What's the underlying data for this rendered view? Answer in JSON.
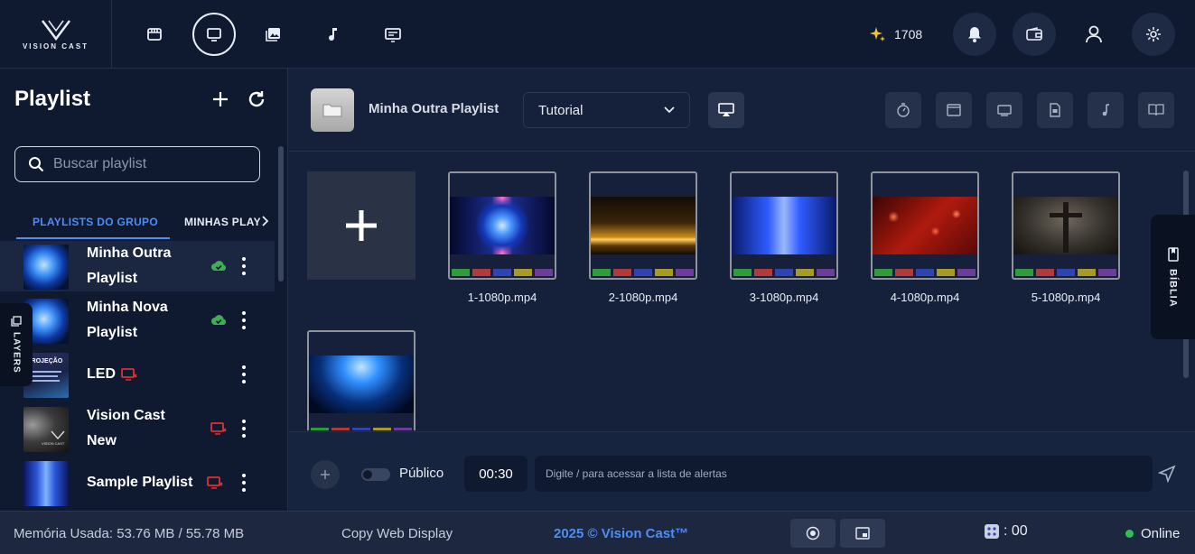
{
  "brand": {
    "name": "VISION CAST"
  },
  "topbar": {
    "nav": [
      {
        "icon": "store-icon"
      },
      {
        "icon": "monitor-icon",
        "active": true
      },
      {
        "icon": "images-icon"
      },
      {
        "icon": "music-icon"
      },
      {
        "icon": "text-screen-icon"
      }
    ],
    "credits": "1708",
    "actions": [
      "bell-icon",
      "wallet-icon",
      "user-icon",
      "settings-icon"
    ]
  },
  "sidebar": {
    "title": "Playlist",
    "search_placeholder": "Buscar playlist",
    "tabs": [
      "PLAYLISTS DO GRUPO",
      "MINHAS PLAYLISTS"
    ],
    "layers_label": "LAYERS",
    "items": [
      {
        "line1": "Minha Outra",
        "line2": "Playlist",
        "status": "cloud-synced",
        "selected": true
      },
      {
        "line1": "Minha Nova",
        "line2": "Playlist",
        "status": "cloud-synced",
        "selected": false
      },
      {
        "line1": "LED",
        "line2": "",
        "status": "cast-offline",
        "selected": false
      },
      {
        "line1": "Vision Cast",
        "line2": "New",
        "status": "cast-offline",
        "selected": false
      },
      {
        "line1": "Sample Playlist",
        "line2": "",
        "status": "cast-offline",
        "selected": false
      }
    ],
    "thumb_texts": {
      "projecao": "PROJEÇÃO",
      "vision": "VISION CAST"
    }
  },
  "main": {
    "playlist_name": "Minha Outra Playlist",
    "dropdown_value": "Tutorial",
    "tools": [
      "timer-icon",
      "window-icon",
      "screen-icon",
      "document-icon",
      "music-note-icon",
      "book-icon"
    ],
    "media": [
      {
        "label": "1-1080p.mp4",
        "theme": "blue-orb"
      },
      {
        "label": "2-1080p.mp4",
        "theme": "gold-particles"
      },
      {
        "label": "3-1080p.mp4",
        "theme": "blue-tunnel"
      },
      {
        "label": "4-1080p.mp4",
        "theme": "red-hearts"
      },
      {
        "label": "5-1080p.mp4",
        "theme": "cross"
      },
      {
        "label": "",
        "theme": "blue-sparkle"
      }
    ],
    "swatch_colors": [
      "#2f9c3b",
      "#b23a3a",
      "#2f44b0",
      "#a89a23",
      "#6c3d99"
    ],
    "biblia_label": "BÍBLIA",
    "alert": {
      "public_label": "Público",
      "timer": "00:30",
      "placeholder": "Digite / para acessar a lista de alertas"
    }
  },
  "footer": {
    "memory": "Memória Usada: 53.76 MB / 55.78 MB",
    "copy_web": "Copy Web Display",
    "copyright": "2025 © Vision Cast™",
    "counter": ": 00",
    "status": "Online"
  },
  "colors": {
    "accent": "#4d8df5",
    "online": "#2fbf55",
    "offline": "#e0302f",
    "synced": "#3fae55"
  }
}
